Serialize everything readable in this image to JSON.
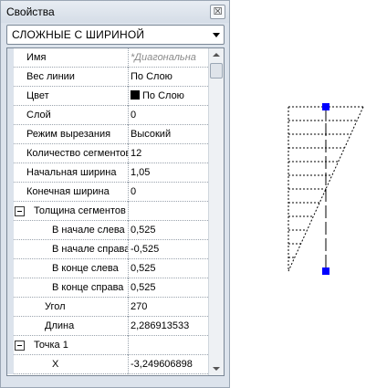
{
  "panel": {
    "title": "Свойства",
    "close_label": "☒",
    "object_type": "СЛОЖНЫЕ С ШИРИНОЙ"
  },
  "properties": [
    {
      "name": "Имя",
      "value": "*Диагональна",
      "placeholder": true
    },
    {
      "name": "Вес линии",
      "value": "По Слою"
    },
    {
      "name": "Цвет",
      "value": "По Слою",
      "swatch": "#000000"
    },
    {
      "name": "Слой",
      "value": "0"
    },
    {
      "name": "Режим вырезания",
      "value": "Высокий"
    },
    {
      "name": "Количество сегментов",
      "value": "12"
    },
    {
      "name": "Начальная ширина",
      "value": "1,05"
    },
    {
      "name": "Конечная ширина",
      "value": "0"
    },
    {
      "name": "Толщина сегментов",
      "value": "",
      "group": true
    },
    {
      "name": "В начале слева",
      "value": "0,525",
      "sub": true
    },
    {
      "name": "В начале справа",
      "value": "-0,525",
      "sub": true
    },
    {
      "name": "В конце слева",
      "value": "0,525",
      "sub": true
    },
    {
      "name": "В конце справа",
      "value": "0,525",
      "sub": true
    },
    {
      "name": "Угол",
      "value": "270",
      "indent": true
    },
    {
      "name": "Длина",
      "value": "2,286913533",
      "indent": true
    },
    {
      "name": "Точка 1",
      "value": "",
      "group": true
    },
    {
      "name": "X",
      "value": "-3,249606898",
      "sub": true
    }
  ],
  "colors": {
    "panel_bg": "#dce3ec",
    "grip_color": "#0000ff",
    "line_color": "#000000"
  }
}
